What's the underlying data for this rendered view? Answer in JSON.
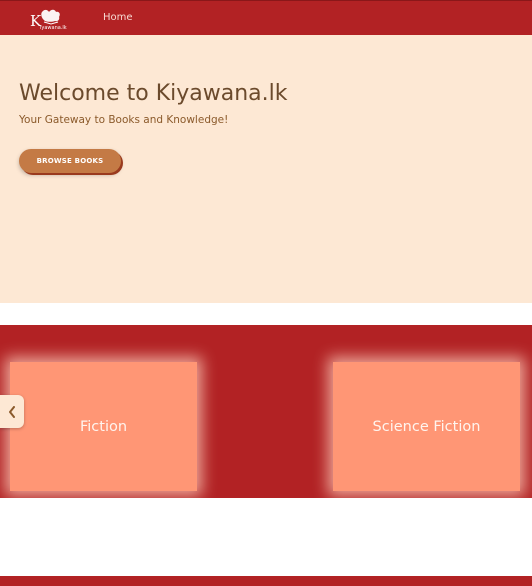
{
  "nav": {
    "logo_text": "Kiyawana.lk",
    "logo_icon": "open-book-logo",
    "home_label": "Home"
  },
  "hero": {
    "title": "Welcome to Kiyawana.lk",
    "subtitle": "Your Gateway to Books and Knowledge!",
    "browse_label": "BROWSE BOOKS"
  },
  "categories": {
    "prev_icon": "chevron-left-icon",
    "items": [
      {
        "label": "Fiction"
      },
      {
        "label": "Science Fiction"
      }
    ]
  },
  "colors": {
    "brand_red": "#b22224",
    "hero_background": "#fde8d4",
    "title_brown": "#6b4a2c",
    "button_brown": "#c47a45",
    "card_salmon": "#ff9675"
  }
}
